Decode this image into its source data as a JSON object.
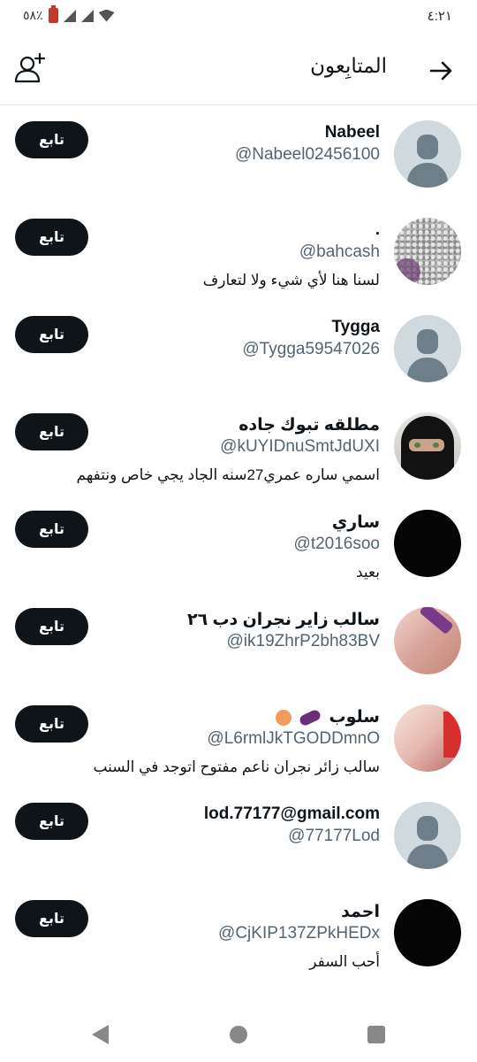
{
  "status_bar": {
    "time": "٤:٢١",
    "battery": "٥٨٪"
  },
  "header": {
    "title": "المتابِعون",
    "back_icon": "arrow-right-icon",
    "add_icon": "add-user-icon"
  },
  "followers": [
    {
      "name": "Nabeel",
      "handle": "@Nabeel02456100",
      "bio": "",
      "button": "تابع",
      "avatar": "default"
    },
    {
      "name": ".",
      "handle": "@bahcash",
      "bio": "لسنا هنا لأي شيء ولا لتعارف",
      "button": "تابع",
      "avatar": "pattern"
    },
    {
      "name": "Tygga",
      "handle": "@Tygga59547026",
      "bio": "",
      "button": "تابع",
      "avatar": "default"
    },
    {
      "name": "مطلقه تبوك جاده",
      "handle": "@kUYIDnuSmtJdUXI",
      "bio": "اسمي ساره عمري27سنه الجاد يجي خاص ونتفهم",
      "button": "تابع",
      "avatar": "niqab"
    },
    {
      "name": "ساري",
      "handle": "@t2016soo",
      "bio": "بعيد",
      "button": "تابع",
      "avatar": "dark"
    },
    {
      "name": "سالب زاير نجران دب ٢٦",
      "handle": "@ik19ZhrP2bh83BV",
      "bio": "",
      "button": "تابع",
      "avatar": "skin"
    },
    {
      "name": "سلوب",
      "handle": "@L6rmlJkTGODDmnO",
      "bio": "سالب زائر نجران ناعم مفتوح اتوجد في السنب",
      "button": "تابع",
      "avatar": "skin2"
    },
    {
      "name": "lod.77177@gmail.com",
      "handle": "@77177Lod",
      "bio": "",
      "button": "تابع",
      "avatar": "default"
    },
    {
      "name": "احمد",
      "handle": "@CjKIP137ZPkHEDx",
      "bio": "أحب السفر",
      "button": "تابع",
      "avatar": "dark"
    }
  ],
  "colors": {
    "button_bg": "#0f1419",
    "handle": "#536471",
    "divider": "#e6e9ec",
    "avatar_default": "#cfd9de"
  }
}
